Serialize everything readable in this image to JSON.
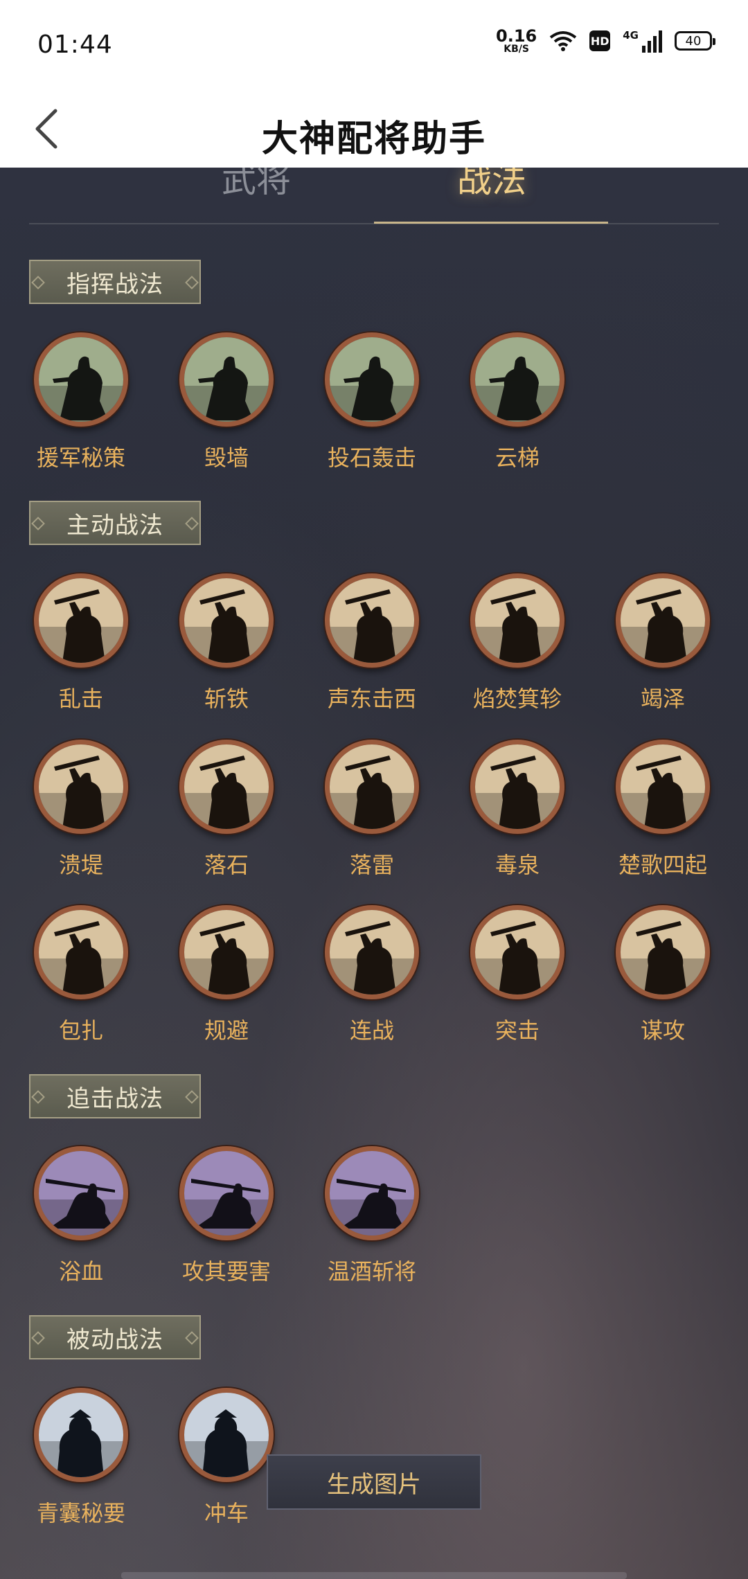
{
  "status_bar": {
    "time": "01:44",
    "net_speed_value": "0.16",
    "net_speed_unit": "KB/S",
    "hd": "HD",
    "network": "4G",
    "battery": "40"
  },
  "header": {
    "title": "大神配将助手"
  },
  "tabs": [
    {
      "label": "武将",
      "active": false
    },
    {
      "label": "战法",
      "active": true
    }
  ],
  "sections": [
    {
      "title": "指挥战法",
      "icon_style": "command",
      "items": [
        "援军秘策",
        "毁墙",
        "投石轰击",
        "云梯"
      ]
    },
    {
      "title": "主动战法",
      "icon_style": "active",
      "items": [
        "乱击",
        "斩铁",
        "声东击西",
        "焰焚箕轸",
        "竭泽",
        "溃堤",
        "落石",
        "落雷",
        "毒泉",
        "楚歌四起",
        "包扎",
        "规避",
        "连战",
        "突击",
        "谋攻"
      ]
    },
    {
      "title": "追击战法",
      "icon_style": "pursuit",
      "items": [
        "浴血",
        "攻其要害",
        "温酒斩将"
      ]
    },
    {
      "title": "被动战法",
      "icon_style": "passive",
      "items": [
        "青囊秘要",
        "冲车"
      ]
    }
  ],
  "generate_button": "生成图片",
  "colors": {
    "label": "#e9b25d",
    "active_tab": "#f1d08a",
    "icon_ring": "#9a5a3c",
    "command_bg": "#9fad8c",
    "active_bg": "#d8c3a0",
    "pursuit_bg": "#9c8ab8",
    "passive_bg": "#c9d2dd"
  }
}
